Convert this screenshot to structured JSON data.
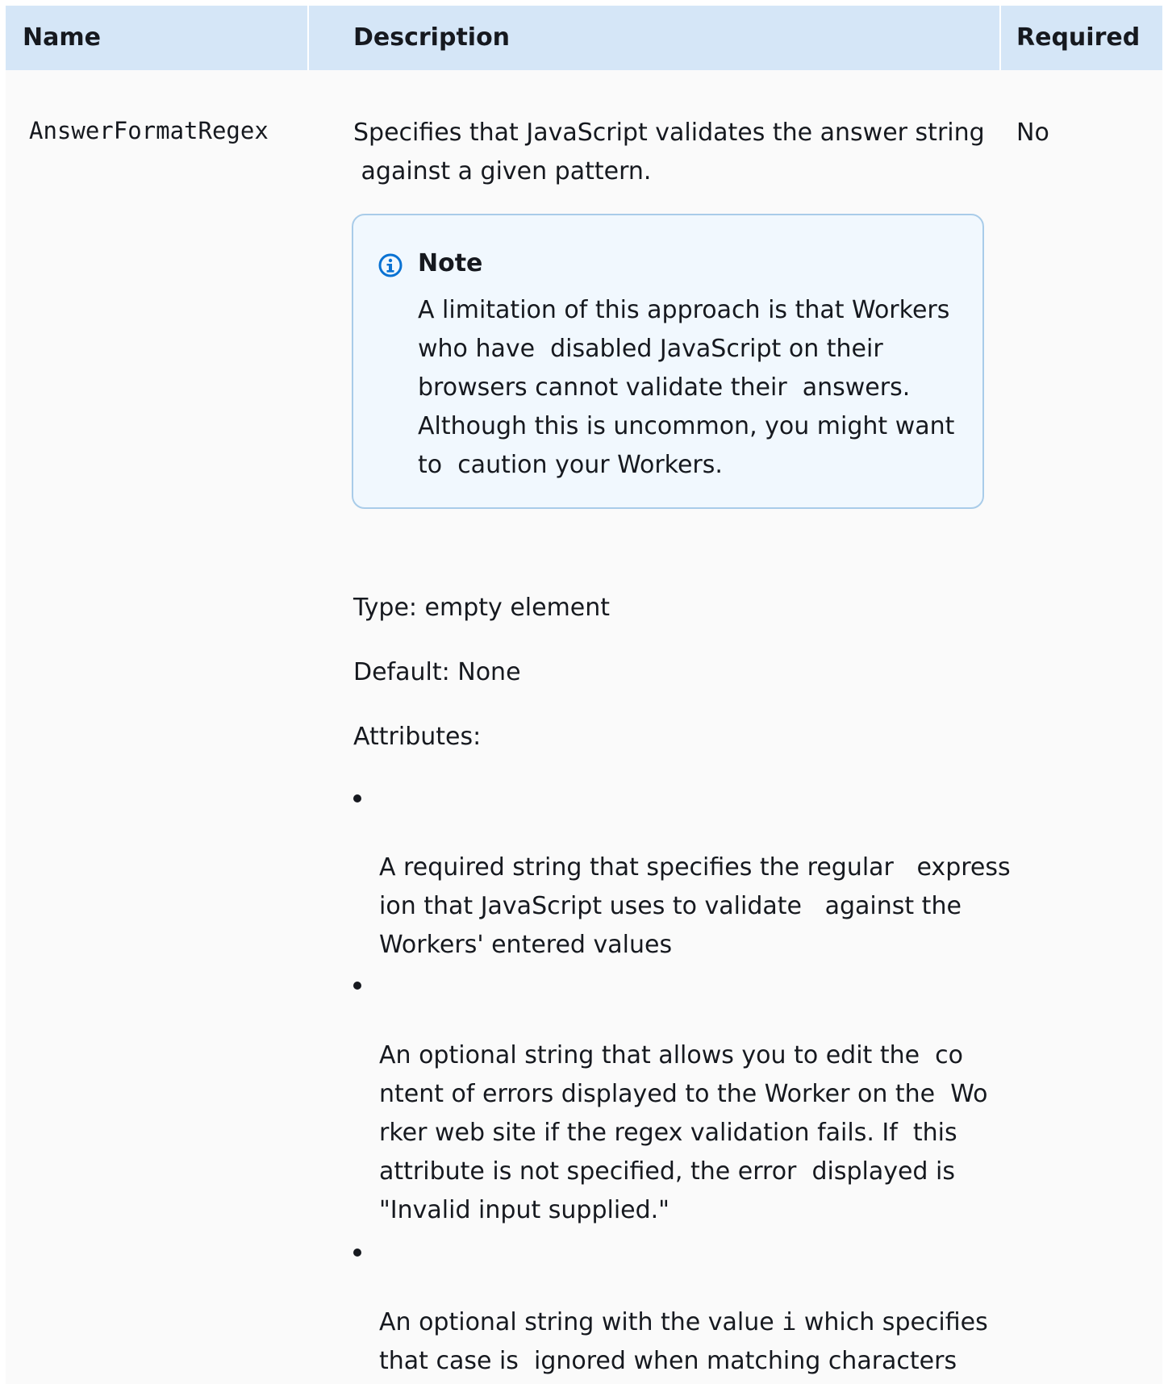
{
  "table": {
    "headers": {
      "name": "Name",
      "description": "Description",
      "required": "Required"
    },
    "row": {
      "name": "AnswerFormatRegex",
      "required": "No",
      "description_lines": [
        "Specifies that JavaScript validates the answer string",
        " against a given pattern."
      ],
      "note": {
        "icon": "info-icon",
        "title": "Note",
        "lines": [
          "A limitation of this approach is that Workers",
          "who have  disabled JavaScript on their",
          "browsers cannot validate their  answers.",
          "Although this is uncommon, you might want",
          "to  caution your Workers."
        ]
      },
      "type": "Type: empty element",
      "default": "Default: None",
      "attributes_label": "Attributes:",
      "attributes": [
        {
          "lines": [
            "A required string that specifies the regular   express",
            "ion that JavaScript uses to validate   against the",
            "Workers' entered values"
          ]
        },
        {
          "lines": [
            "An optional string that allows you to edit the  co",
            "ntent of errors displayed to the Worker on the  Wo",
            "rker web site if the regex validation fails. If  this",
            "attribute is not specified, the error  displayed is",
            "\"Invalid input supplied.\""
          ]
        },
        {
          "line1_prefix": "An optional string with the value ",
          "line1_code": "i",
          "line1_suffix": " which specifies",
          "line2": "that case is  ignored when matching characters"
        }
      ]
    }
  },
  "colors": {
    "header_bg": "#d5e6f7",
    "note_bg": "#f1f8fe",
    "note_border": "#a9cce9",
    "info_icon": "#0972d3",
    "text": "#16191f"
  }
}
